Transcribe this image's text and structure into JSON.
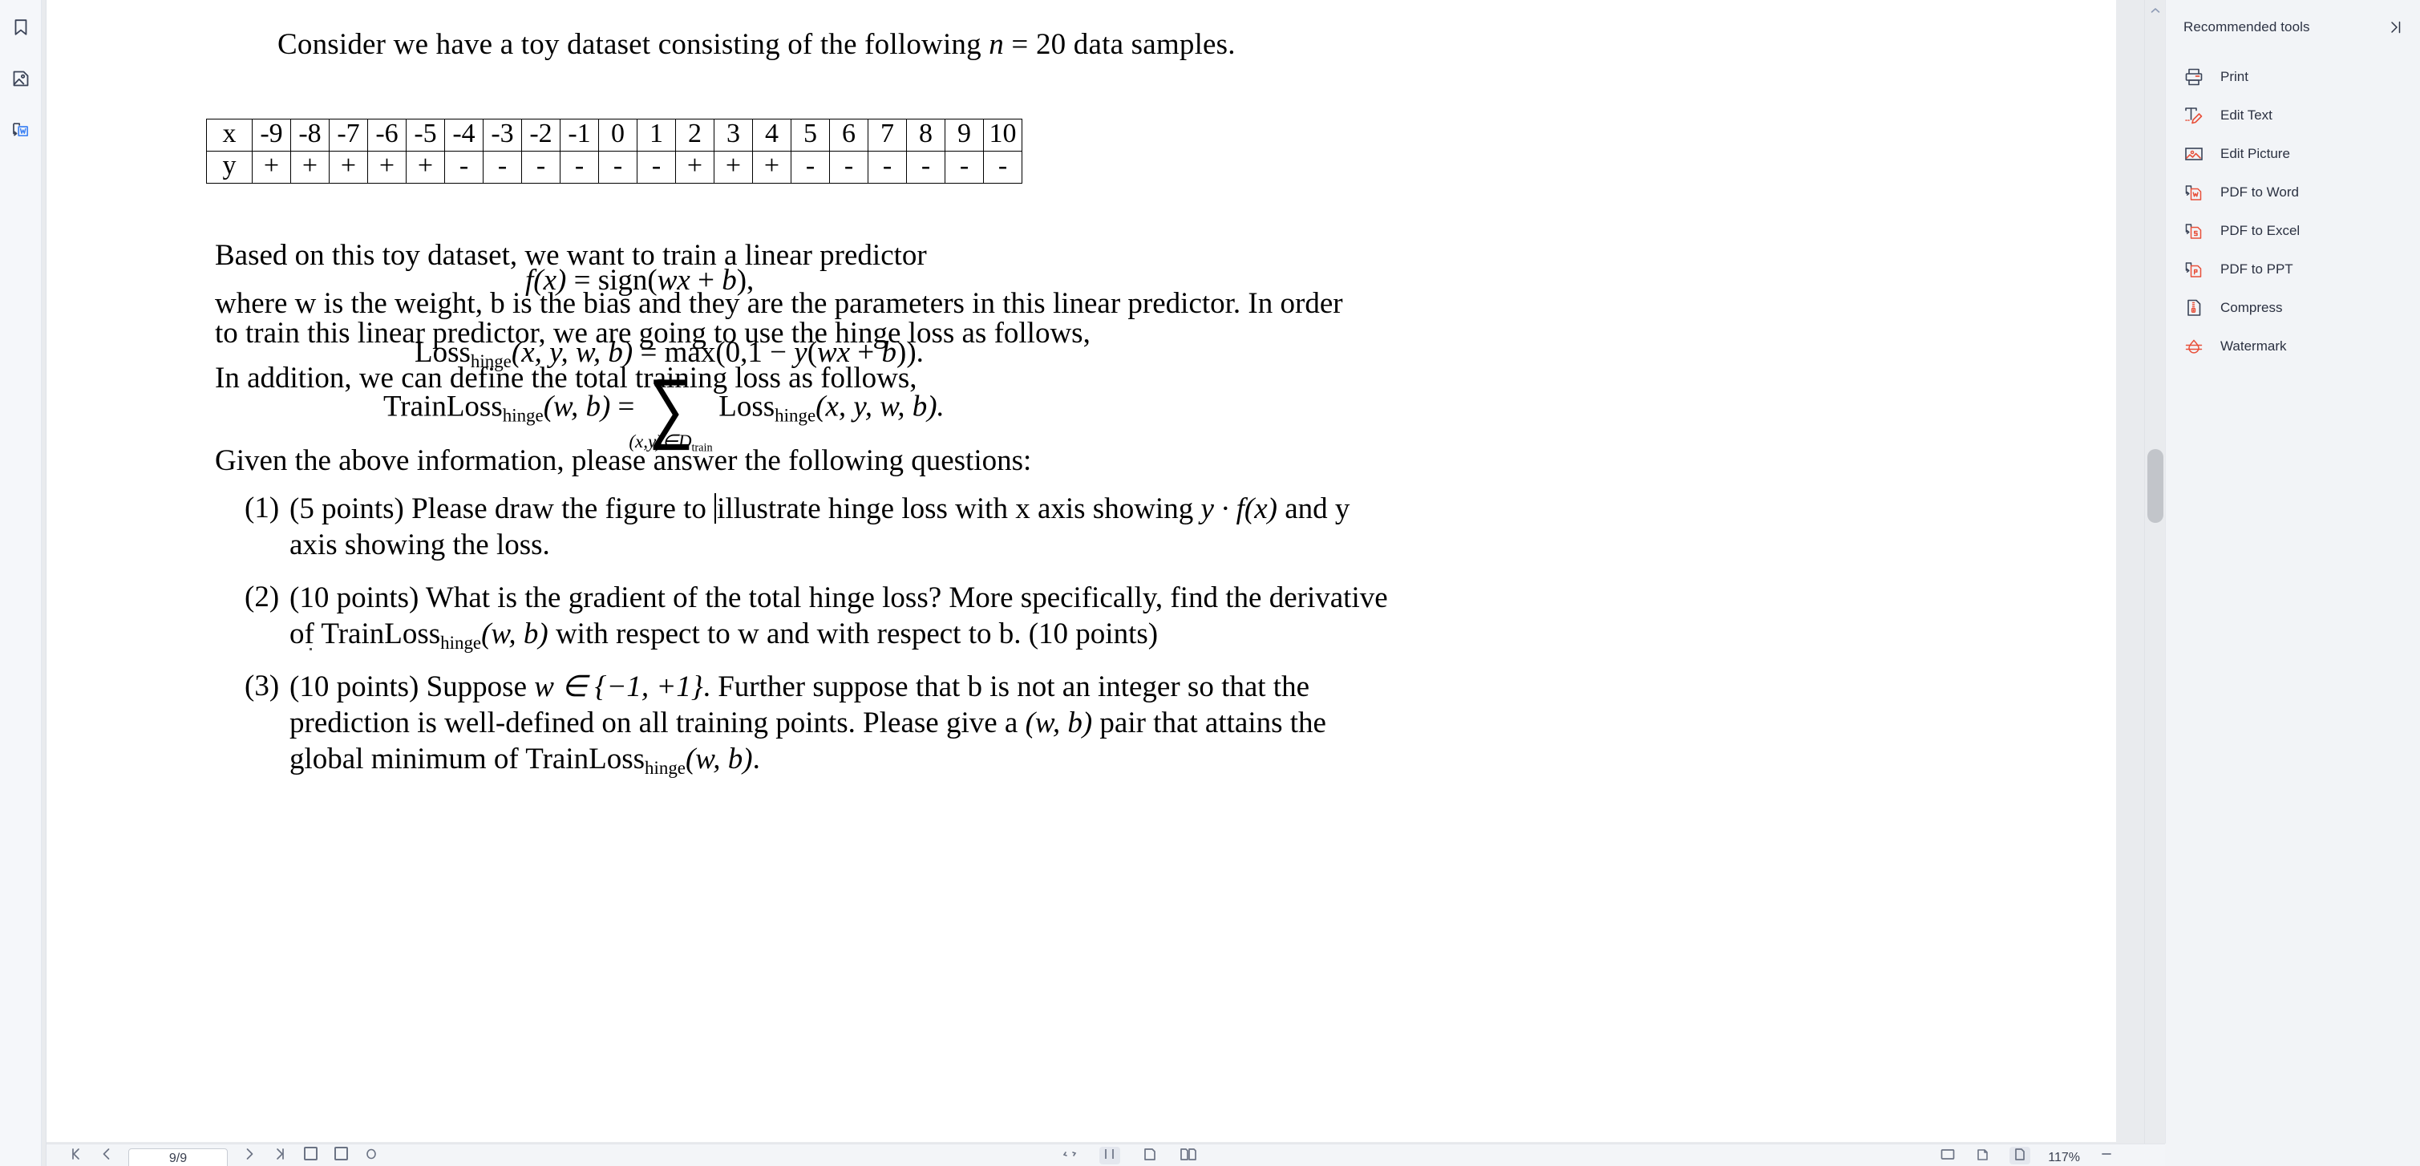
{
  "left_rail": {
    "items": [
      {
        "name": "bookmark-icon",
        "label": "Bookmark"
      },
      {
        "name": "thumbnail-icon",
        "label": "Page Thumbnails"
      },
      {
        "name": "convert-word-icon",
        "label": "Convert to Word"
      }
    ]
  },
  "document": {
    "title_line": "Consider we have a toy dataset consisting of the following n = 20 data samples.",
    "title_parts": {
      "before": "Consider we have a toy dataset consisting of the following ",
      "var": "n",
      "after": " = 20 data samples."
    },
    "table": {
      "row_labels": [
        "x",
        "y"
      ],
      "x": [
        "-9",
        "-8",
        "-7",
        "-6",
        "-5",
        "-4",
        "-3",
        "-2",
        "-1",
        "0",
        "1",
        "2",
        "3",
        "4",
        "5",
        "6",
        "7",
        "8",
        "9",
        "10"
      ],
      "y": [
        "+",
        "+",
        "+",
        "+",
        "+",
        "-",
        "-",
        "-",
        "-",
        "-",
        "-",
        "+",
        "+",
        "+",
        "-",
        "-",
        "-",
        "-",
        "-",
        "-"
      ]
    },
    "paragraphs": {
      "based_on": "Based on this toy dataset, we want to train a linear predictor",
      "where_line1": "where w is the weight, b is the bias and they are the parameters in this linear predictor. In order",
      "where_line2": "to train this linear predictor, we are going to use the hinge loss as follows,",
      "in_addition": "In addition, we can define the total training loss as follows,",
      "given_above": "Given the above information, please answer the following questions:"
    },
    "equations": {
      "f_of_x": "f(x) = sign(wx + b),",
      "f_lhs": "f",
      "f_arg": "(x)",
      "f_eq": " = sign(",
      "f_wx": "wx",
      "f_plus": " + ",
      "f_b": "b",
      "f_close": "),",
      "hinge_name": "Loss",
      "hinge_sub": "hinge",
      "hinge_args": "(x, y, w, b)",
      "hinge_rhs_1": " = max(0,1 − ",
      "hinge_y": "y",
      "hinge_rhs_2": "(",
      "hinge_wx": "wx",
      "hinge_rhs_3": " + ",
      "hinge_b": "b",
      "hinge_rhs_4": ")).",
      "train_name": "TrainLoss",
      "train_sub": "hinge",
      "train_args": "(w, b)",
      "train_eq": " = ",
      "sum_symbol": "∑",
      "sum_limit": "(x,y)∈D",
      "sum_limit_sub": "train",
      "sum_term_name": "Loss",
      "sum_term_sub": "hinge",
      "sum_term_args": "(x, y, w, b)."
    },
    "questions": [
      {
        "num": "(1)",
        "lines": [
          {
            "pre": "(5 points) Please draw the figure to ",
            "caret": true,
            "post": "illustrate hinge loss with x axis showing ",
            "math": "y · f(x)",
            "tail": " and y"
          },
          {
            "pre": "axis showing the loss."
          }
        ]
      },
      {
        "num": "(2)",
        "lines": [
          {
            "pre": " (10 points) What is the gradient of the total hinge loss? More specifically, find the derivative"
          },
          {
            "pre": "of TrainLoss",
            "sub": "hinge",
            "math": "(w, b)",
            "tail": " with respect to w and with respect to b. (10 points)"
          }
        ]
      },
      {
        "num": "(3)",
        "lines": [
          {
            "pre": "(10 points) Suppose ",
            "math": "w ∈ {−1, +1}",
            "tail": ". Further suppose that b is not an integer so that the"
          },
          {
            "pre": "prediction is well-defined on all training points. Please give a ",
            "math": "(w, b)",
            "tail": " pair that attains the"
          },
          {
            "pre": "global minimum of TrainLoss",
            "sub": "hinge",
            "math": "(w, b)",
            "tail": "."
          }
        ]
      }
    ]
  },
  "tools_panel": {
    "title": "Recommended tools",
    "collapse_icon": "collapse-right-icon",
    "items": [
      {
        "label": "Print",
        "icon": "printer-icon"
      },
      {
        "label": "Edit Text",
        "icon": "edit-text-icon"
      },
      {
        "label": "Edit Picture",
        "icon": "edit-picture-icon"
      },
      {
        "label": "PDF to Word",
        "icon": "pdf-to-word-icon"
      },
      {
        "label": "PDF to Excel",
        "icon": "pdf-to-excel-icon"
      },
      {
        "label": "PDF to PPT",
        "icon": "pdf-to-ppt-icon"
      },
      {
        "label": "Compress",
        "icon": "compress-icon"
      },
      {
        "label": "Watermark",
        "icon": "watermark-icon"
      }
    ]
  },
  "bottom_bar": {
    "page_value": "9/9",
    "zoom_value": "117%"
  },
  "colors": {
    "accent_blue": "#4285f4",
    "icon_navy": "#3a4357",
    "icon_red": "#e8503a",
    "panel_bg": "#f2f4f7",
    "viewport_bg": "#e9ebee"
  }
}
